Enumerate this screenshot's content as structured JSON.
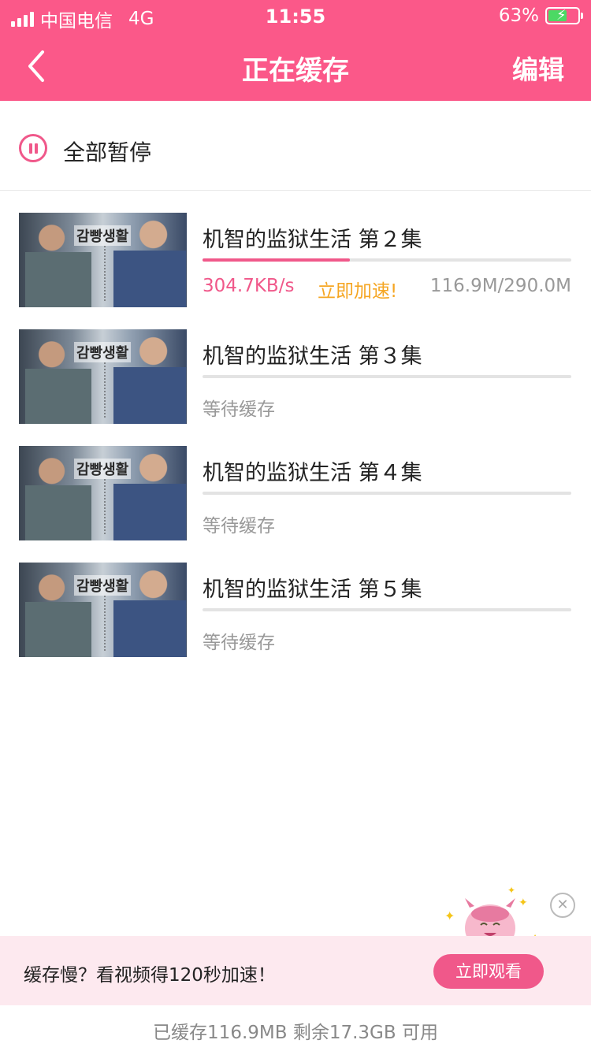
{
  "status_bar": {
    "carrier": "中国电信",
    "network": "4G",
    "time": "11:55",
    "battery_percent": "63%",
    "battery_level": 0.63
  },
  "header": {
    "back_icon": "chevron-left-icon",
    "title": "正在缓存",
    "edit_label": "编辑"
  },
  "pause_all": {
    "icon": "pause-circle-icon",
    "label": "全部暂停"
  },
  "downloads": [
    {
      "title": "机智的监狱生活 第２集",
      "poster_text": "감빵생활",
      "progress": 0.4,
      "speed": "304.7KB/s",
      "boost_label": "立即加速!",
      "size": "116.9M/290.0M",
      "status": ""
    },
    {
      "title": "机智的监狱生活 第３集",
      "poster_text": "감빵생활",
      "progress": 0,
      "status": "等待缓存"
    },
    {
      "title": "机智的监狱生活 第４集",
      "poster_text": "감빵생활",
      "progress": 0,
      "status": "等待缓存"
    },
    {
      "title": "机智的监狱生活 第５集",
      "poster_text": "감빵생활",
      "progress": 0,
      "status": "等待缓存"
    }
  ],
  "promo": {
    "text": "缓存慢？看视频得120秒加速！",
    "button_label": "立即观看",
    "close_icon": "close-icon",
    "mascot_icon": "mascot-icon"
  },
  "footer": {
    "storage_text": "已缓存116.9MB 剩余17.3GB 可用"
  },
  "colors": {
    "accent": "#fb5889",
    "pink_text": "#f0588a",
    "boost": "#f5a623",
    "promo_bg": "#fde9ef"
  }
}
